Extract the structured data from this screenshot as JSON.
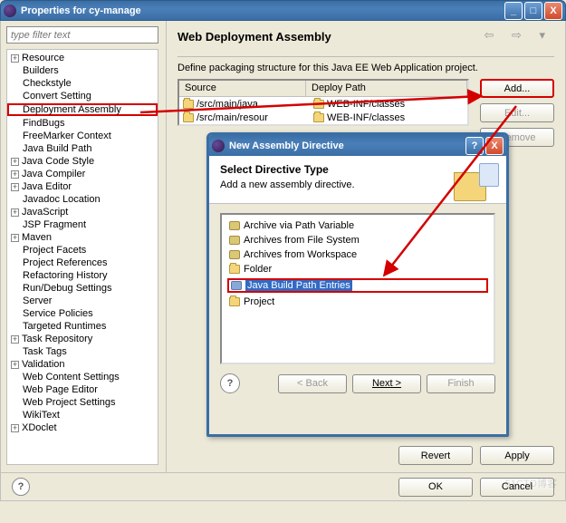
{
  "window": {
    "title": "Properties for cy-manage",
    "minimize_label": "_",
    "maximize_label": "□",
    "close_label": "X"
  },
  "filter": {
    "placeholder": "type filter text"
  },
  "tree": {
    "items": [
      {
        "label": "Resource",
        "expandable": true
      },
      {
        "label": "Builders",
        "expandable": false
      },
      {
        "label": "Checkstyle",
        "expandable": false
      },
      {
        "label": "Convert Setting",
        "expandable": false
      },
      {
        "label": "Deployment Assembly",
        "expandable": false,
        "highlight": true
      },
      {
        "label": "FindBugs",
        "expandable": false
      },
      {
        "label": "FreeMarker Context",
        "expandable": false
      },
      {
        "label": "Java Build Path",
        "expandable": false
      },
      {
        "label": "Java Code Style",
        "expandable": true
      },
      {
        "label": "Java Compiler",
        "expandable": true
      },
      {
        "label": "Java Editor",
        "expandable": true
      },
      {
        "label": "Javadoc Location",
        "expandable": false
      },
      {
        "label": "JavaScript",
        "expandable": true
      },
      {
        "label": "JSP Fragment",
        "expandable": false
      },
      {
        "label": "Maven",
        "expandable": true
      },
      {
        "label": "Project Facets",
        "expandable": false
      },
      {
        "label": "Project References",
        "expandable": false
      },
      {
        "label": "Refactoring History",
        "expandable": false
      },
      {
        "label": "Run/Debug Settings",
        "expandable": false
      },
      {
        "label": "Server",
        "expandable": false
      },
      {
        "label": "Service Policies",
        "expandable": false
      },
      {
        "label": "Targeted Runtimes",
        "expandable": false
      },
      {
        "label": "Task Repository",
        "expandable": true
      },
      {
        "label": "Task Tags",
        "expandable": false
      },
      {
        "label": "Validation",
        "expandable": true
      },
      {
        "label": "Web Content Settings",
        "expandable": false
      },
      {
        "label": "Web Page Editor",
        "expandable": false
      },
      {
        "label": "Web Project Settings",
        "expandable": false
      },
      {
        "label": "WikiText",
        "expandable": false
      },
      {
        "label": "XDoclet",
        "expandable": true
      }
    ]
  },
  "panel": {
    "heading": "Web Deployment Assembly",
    "description": "Define packaging structure for this Java EE Web Application project.",
    "columns": {
      "source": "Source",
      "deploy": "Deploy Path"
    },
    "rows": [
      {
        "source": "/src/main/java",
        "deploy": "WEB-INF/classes"
      },
      {
        "source": "/src/main/resour",
        "deploy": "WEB-INF/classes"
      }
    ],
    "buttons": {
      "add": "Add...",
      "edit": "Edit...",
      "remove": "Remove"
    },
    "revert": "Revert",
    "apply": "Apply"
  },
  "dialog": {
    "title": "New Assembly Directive",
    "heading": "Select Directive Type",
    "sub": "Add a new assembly directive.",
    "items": [
      {
        "label": "Archive via Path Variable",
        "icon": "jar"
      },
      {
        "label": "Archives from File System",
        "icon": "jar"
      },
      {
        "label": "Archives from Workspace",
        "icon": "jar"
      },
      {
        "label": "Folder",
        "icon": "folder"
      },
      {
        "label": "Java Build Path Entries",
        "icon": "jar-blue",
        "selected": true,
        "boxed": true
      },
      {
        "label": "Project",
        "icon": "folder"
      }
    ],
    "buttons": {
      "back": "< Back",
      "next": "Next >",
      "finish": "Finish"
    },
    "help": "?"
  },
  "footer": {
    "ok": "OK",
    "cancel": "Cancel",
    "help": "?"
  },
  "watermark": "51CTO博客"
}
